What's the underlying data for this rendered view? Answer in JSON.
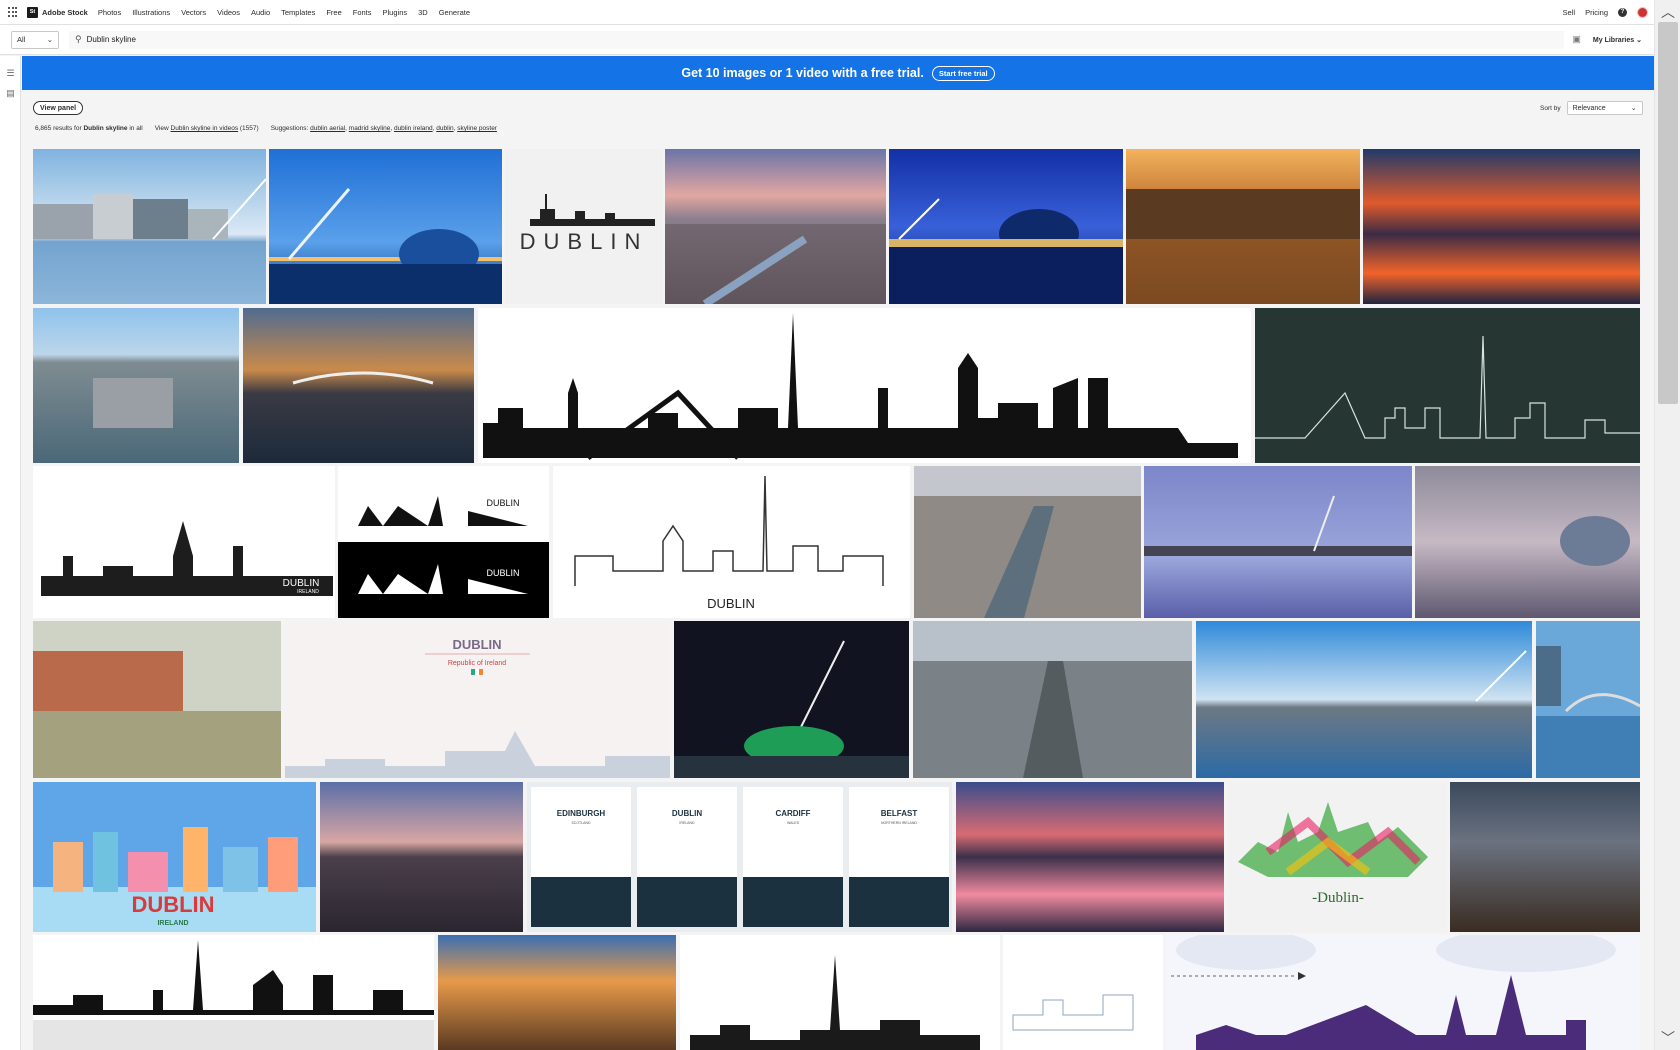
{
  "nav": {
    "logo_mark": "St",
    "logo_text": "Adobe Stock",
    "items": [
      "Photos",
      "Illustrations",
      "Vectors",
      "Videos",
      "Audio",
      "Templates",
      "Free",
      "Fonts",
      "Plugins",
      "3D",
      "Generate"
    ],
    "right": [
      "Sell",
      "Pricing"
    ],
    "help_label": "?"
  },
  "search": {
    "filter_value": "All",
    "query": "Dublin skyline",
    "libraries_label": "My Libraries"
  },
  "banner": {
    "text": "Get 10 images or 1 video with a free trial.",
    "button": "Start free trial"
  },
  "toolbar": {
    "view_panel": "View panel",
    "sort_label": "Sort by",
    "sort_value": "Relevance"
  },
  "results": {
    "count": "6,865",
    "results_for": "results for",
    "query": "Dublin skyline",
    "in_all": "in all",
    "view": "View",
    "videos_link": "Dublin skyline in videos",
    "videos_count": "(1557)",
    "suggestions_label": "Suggestions:",
    "suggestions": [
      "dublin aerial",
      "madrid skyline",
      "dublin ireland",
      "dublin",
      "skyline poster"
    ]
  },
  "tile_texts": {
    "dublin_word": "DUBLIN",
    "ireland": "IRELAND",
    "republic": "Republic of Ireland",
    "script_dublin": "-Dublin-",
    "posters": [
      {
        "city": "EDINBURGH",
        "country": "SCOTLAND"
      },
      {
        "city": "DUBLIN",
        "country": "IRELAND"
      },
      {
        "city": "CARDIFF",
        "country": "WALES"
      },
      {
        "city": "BELFAST",
        "country": "NORTHERN IRELAND"
      }
    ]
  }
}
